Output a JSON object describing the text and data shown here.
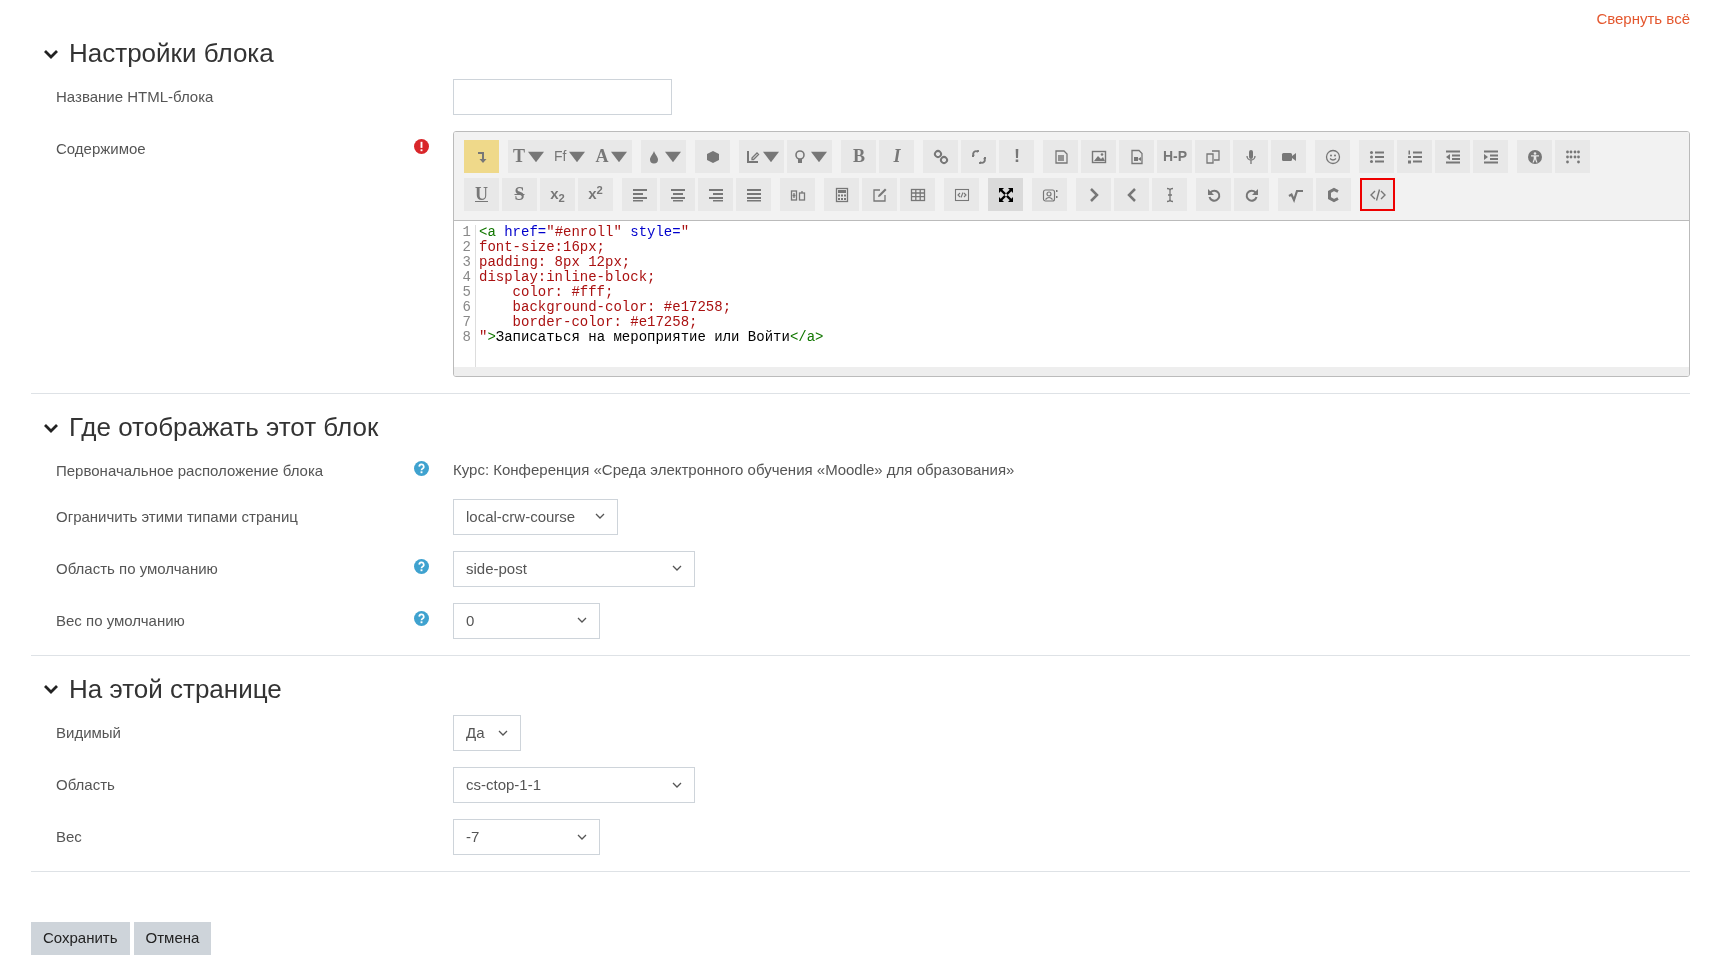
{
  "collapse_all": "Свернуть всё",
  "sections": [
    {
      "title": "Настройки блока",
      "expanded": true,
      "fields": [
        {
          "kind": "text",
          "label": "Название HTML-блока",
          "help": false,
          "required": false
        },
        {
          "kind": "editor",
          "label": "Содержимое",
          "help": false,
          "required": true,
          "toolbar": [
            [
              [
                {
                  "active": true,
                  "pressed": false,
                  "outlined": false,
                  "dropdown": false
                }
              ],
              [
                {
                  "label": "T",
                  "active": false,
                  "pressed": false,
                  "outlined": false,
                  "dropdown": true
                },
                {
                  "label": "Ff",
                  "active": false,
                  "pressed": false,
                  "outlined": false,
                  "dropdown": true
                },
                {
                  "label": "A",
                  "active": false,
                  "pressed": false,
                  "outlined": false,
                  "dropdown": true
                }
              ],
              [
                {
                  "active": false,
                  "pressed": false,
                  "outlined": false,
                  "dropdown": true
                }
              ],
              [
                {
                  "active": false,
                  "pressed": false,
                  "outlined": false,
                  "dropdown": false
                }
              ],
              [
                {
                  "active": false,
                  "pressed": false,
                  "outlined": false,
                  "dropdown": true
                },
                {
                  "active": false,
                  "pressed": false,
                  "outlined": false,
                  "dropdown": true
                }
              ],
              [
                {
                  "label": "B",
                  "active": false,
                  "pressed": false,
                  "outlined": false,
                  "dropdown": false
                },
                {
                  "label": "I",
                  "active": false,
                  "pressed": false,
                  "outlined": false,
                  "dropdown": false
                }
              ],
              [
                {
                  "active": false,
                  "pressed": false,
                  "outlined": false,
                  "dropdown": false
                },
                {
                  "active": false,
                  "pressed": false,
                  "outlined": false,
                  "dropdown": false
                },
                {
                  "label": "!",
                  "active": false,
                  "pressed": false,
                  "outlined": false,
                  "dropdown": false
                }
              ],
              [
                {
                  "active": false,
                  "pressed": false,
                  "outlined": false,
                  "dropdown": false
                },
                {
                  "active": false,
                  "pressed": false,
                  "outlined": false,
                  "dropdown": false
                },
                {
                  "active": false,
                  "pressed": false,
                  "outlined": false,
                  "dropdown": false
                },
                {
                  "label": "H-P",
                  "active": false,
                  "pressed": false,
                  "outlined": false,
                  "dropdown": false
                },
                {
                  "active": false,
                  "pressed": false,
                  "outlined": false,
                  "dropdown": false
                },
                {
                  "active": false,
                  "pressed": false,
                  "outlined": false,
                  "dropdown": false
                },
                {
                  "active": false,
                  "pressed": false,
                  "outlined": false,
                  "dropdown": false
                }
              ],
              [
                {
                  "active": false,
                  "pressed": false,
                  "outlined": false,
                  "dropdown": false
                }
              ],
              [
                {
                  "active": false,
                  "pressed": false,
                  "outlined": false,
                  "dropdown": false
                },
                {
                  "active": false,
                  "pressed": false,
                  "outlined": false,
                  "dropdown": false
                },
                {
                  "active": false,
                  "pressed": false,
                  "outlined": false,
                  "dropdown": false
                },
                {
                  "active": false,
                  "pressed": false,
                  "outlined": false,
                  "dropdown": false
                }
              ],
              [
                {
                  "active": false,
                  "pressed": false,
                  "outlined": false,
                  "dropdown": false
                },
                {
                  "active": false,
                  "pressed": false,
                  "outlined": false,
                  "dropdown": false
                }
              ]
            ],
            [
              [
                {
                  "label": "U",
                  "active": false,
                  "pressed": false,
                  "outlined": false,
                  "dropdown": false
                },
                {
                  "label": "S",
                  "active": false,
                  "pressed": false,
                  "outlined": false,
                  "dropdown": false
                },
                {
                  "label": "x$_{2}$",
                  "active": false,
                  "pressed": false,
                  "outlined": false,
                  "dropdown": false
                },
                {
                  "label": "x$^{2}$",
                  "active": false,
                  "pressed": false,
                  "outlined": false,
                  "dropdown": false
                }
              ],
              [
                {
                  "active": false,
                  "pressed": false,
                  "outlined": false,
                  "dropdown": false
                },
                {
                  "active": false,
                  "pressed": false,
                  "outlined": false,
                  "dropdown": false
                },
                {
                  "active": false,
                  "pressed": false,
                  "outlined": false,
                  "dropdown": false
                },
                {
                  "active": false,
                  "pressed": false,
                  "outlined": false,
                  "dropdown": false
                }
              ],
              [
                {
                  "active": false,
                  "pressed": false,
                  "outlined": false,
                  "dropdown": false
                }
              ],
              [
                {
                  "active": false,
                  "pressed": false,
                  "outlined": false,
                  "dropdown": false
                },
                {
                  "active": false,
                  "pressed": false,
                  "outlined": false,
                  "dropdown": false
                },
                {
                  "active": false,
                  "pressed": false,
                  "outlined": false,
                  "dropdown": false
                }
              ],
              [
                {
                  "active": false,
                  "pressed": false,
                  "outlined": false,
                  "dropdown": false
                }
              ],
              [
                {
                  "active": false,
                  "pressed": true,
                  "outlined": false,
                  "dropdown": false
                }
              ],
              [
                {
                  "active": false,
                  "pressed": false,
                  "outlined": false,
                  "dropdown": false
                }
              ],
              [
                {
                  "active": false,
                  "pressed": false,
                  "outlined": false,
                  "dropdown": false
                },
                {
                  "active": false,
                  "pressed": false,
                  "outlined": false,
                  "dropdown": false
                },
                {
                  "active": false,
                  "pressed": false,
                  "outlined": false,
                  "dropdown": false
                }
              ],
              [
                {
                  "active": false,
                  "pressed": false,
                  "outlined": false,
                  "dropdown": false
                },
                {
                  "active": false,
                  "pressed": false,
                  "outlined": false,
                  "dropdown": false
                }
              ],
              [
                {
                  "active": false,
                  "pressed": false,
                  "outlined": false,
                  "dropdown": false
                },
                {
                  "active": false,
                  "pressed": false,
                  "outlined": false,
                  "dropdown": false
                }
              ],
              [
                {
                  "active": false,
                  "pressed": false,
                  "outlined": true,
                  "dropdown": false
                }
              ]
            ]
          ],
          "code_lines": [
            {
              "number": "1",
              "tokens": [
                {
                  "kind": "tag",
                  "text": "<a"
                },
                {
                  "kind": "attr",
                  "text": " href="
                },
                {
                  "kind": "string",
                  "text": "\"#enroll\""
                },
                {
                  "kind": "attr",
                  "text": " style="
                },
                {
                  "kind": "string",
                  "text": "\""
                }
              ]
            },
            {
              "number": "2",
              "tokens": [
                {
                  "kind": "string",
                  "text": "font-size:16px;"
                }
              ]
            },
            {
              "number": "3",
              "tokens": [
                {
                  "kind": "string",
                  "text": "padding: 8px 12px;"
                }
              ]
            },
            {
              "number": "4",
              "tokens": [
                {
                  "kind": "string",
                  "text": "display:inline-block;"
                }
              ]
            },
            {
              "number": "5",
              "tokens": [
                {
                  "kind": "string",
                  "text": "    color: #fff;"
                }
              ]
            },
            {
              "number": "6",
              "tokens": [
                {
                  "kind": "string",
                  "text": "    background-color: #e17258;"
                }
              ]
            },
            {
              "number": "7",
              "tokens": [
                {
                  "kind": "string",
                  "text": "    border-color: #e17258;"
                }
              ]
            },
            {
              "number": "8",
              "tokens": [
                {
                  "kind": "string",
                  "text": "\""
                },
                {
                  "kind": "tag",
                  "text": ">"
                },
                {
                  "kind": "text",
                  "text": "Записаться на мероприятие или Войти"
                },
                {
                  "kind": "tag",
                  "text": "</a>"
                }
              ]
            }
          ]
        }
      ]
    },
    {
      "title": "Где отображать этот блок",
      "expanded": true,
      "fields": [
        {
          "kind": "static",
          "label": "Первоначальное расположение блока",
          "help": true,
          "required": false,
          "value": "Курс: Конференция «Среда электронного обучения «Moodle» для образования»"
        },
        {
          "kind": "select",
          "label": "Ограничить этими типами страниц",
          "help": false,
          "required": false,
          "value": "local-crw-course"
        },
        {
          "kind": "select",
          "label": "Область по умолчанию",
          "help": true,
          "required": false,
          "value": "side-post"
        },
        {
          "kind": "select",
          "label": "Вес по умолчанию",
          "help": true,
          "required": false,
          "value": "0"
        }
      ]
    },
    {
      "title": "На этой странице",
      "expanded": true,
      "fields": [
        {
          "kind": "select",
          "label": "Видимый",
          "help": false,
          "required": false,
          "value": "Да"
        },
        {
          "kind": "select",
          "label": "Область",
          "help": false,
          "required": false,
          "value": "cs-ctop-1-1"
        },
        {
          "kind": "select",
          "label": "Вес",
          "help": false,
          "required": false,
          "value": "-7"
        }
      ]
    }
  ],
  "buttons": [
    {
      "label": "Сохранить"
    },
    {
      "label": "Отмена"
    }
  ]
}
